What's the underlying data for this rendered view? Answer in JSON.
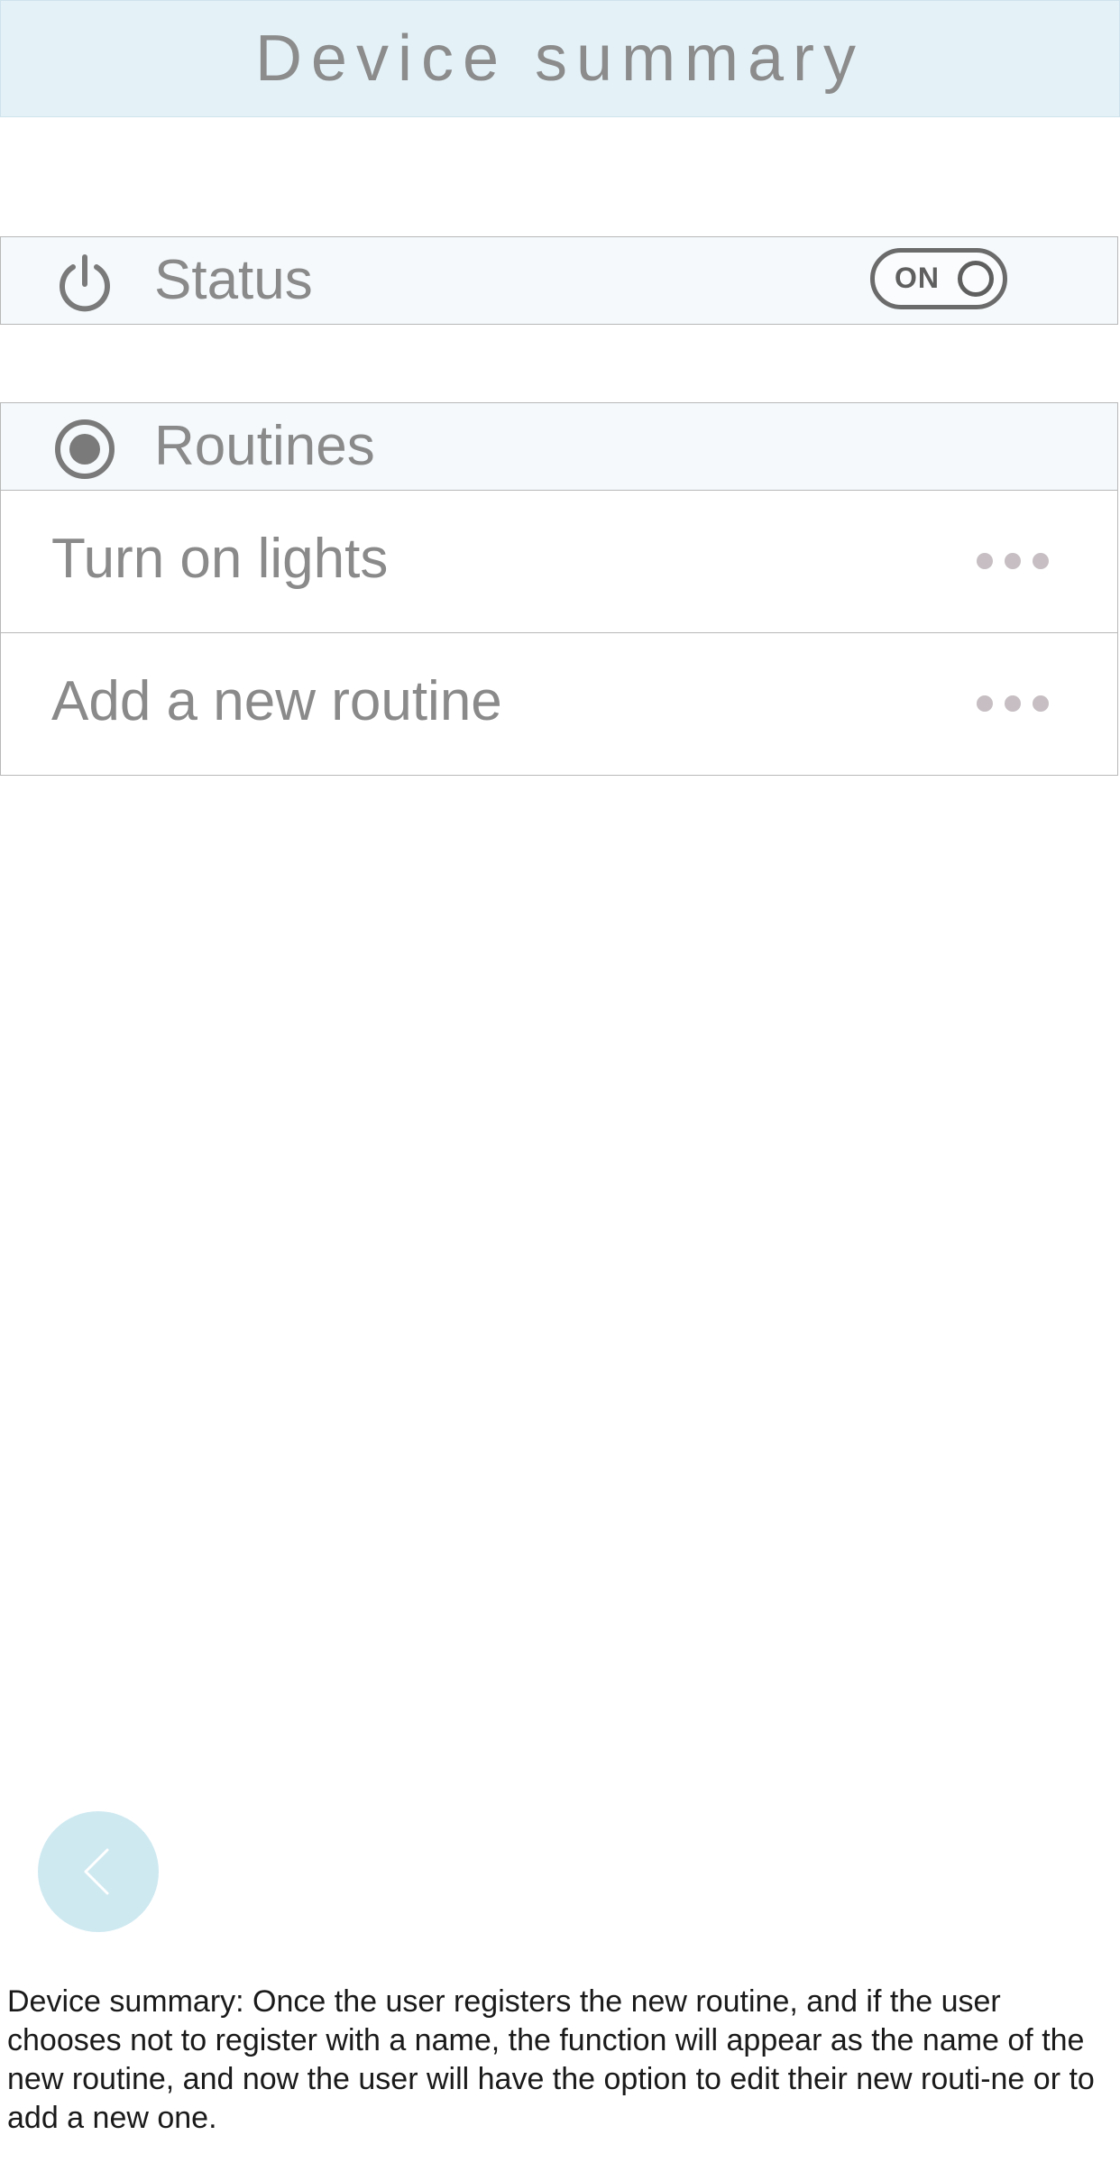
{
  "header": {
    "title": "Device summary"
  },
  "status_section": {
    "label": "Status",
    "icon": "power-icon",
    "toggle": {
      "label": "ON",
      "state": "on"
    }
  },
  "routines_section": {
    "label": "Routines",
    "icon": "radio-selected-icon",
    "items": [
      {
        "label": "Turn on lights",
        "action_icon": "more-dots-icon"
      },
      {
        "label": "Add a new routine",
        "action_icon": "more-dots-icon"
      }
    ]
  },
  "navigation": {
    "back_icon": "chevron-left-icon"
  },
  "caption": {
    "text": "Device summary: Once the user registers the new routine, and if the user chooses not to register with a name, the function will appear as the name of the new routine, and now the user will have the option to edit their new routi-ne or to add a new one."
  },
  "colors": {
    "header_bg": "#e4f2f8",
    "section_bg": "#f5f9fc",
    "text_gray": "#8a8a8a",
    "dots": "#c6bec2",
    "back_button_bg": "#cfe9f1"
  }
}
